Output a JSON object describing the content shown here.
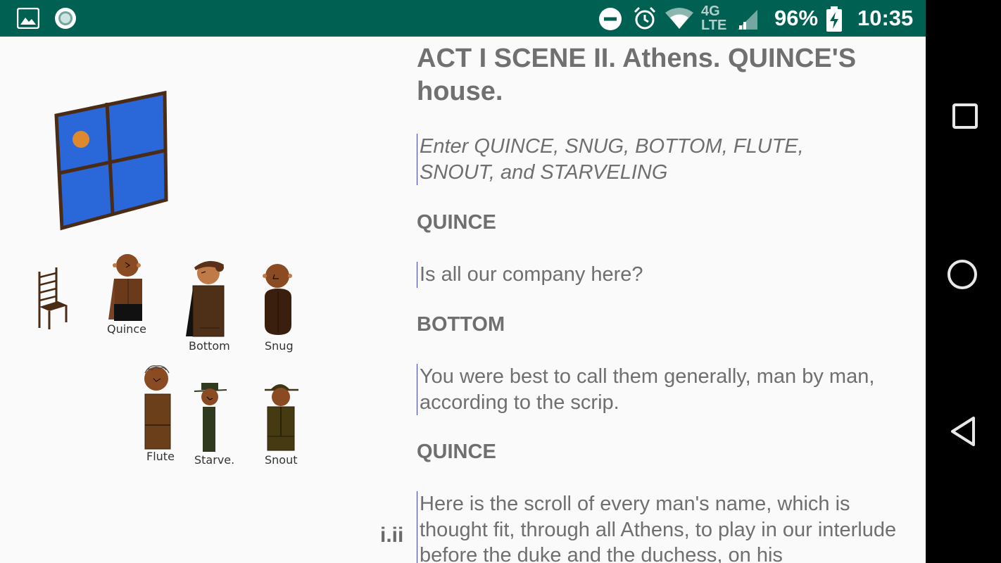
{
  "status_bar": {
    "battery": "96%",
    "time": "10:35",
    "network": "4G LTE"
  },
  "stage": {
    "characters": [
      {
        "name": "Quince"
      },
      {
        "name": "Bottom"
      },
      {
        "name": "Snug"
      },
      {
        "name": "Flute"
      },
      {
        "name": "Starve."
      },
      {
        "name": "Snout"
      }
    ]
  },
  "script": {
    "scene_title": "ACT I SCENE II. Athens. QUINCE'S house.",
    "stage_direction": "Enter QUINCE, SNUG, BOTTOM, FLUTE, SNOUT, and STARVELING",
    "lines": [
      {
        "speaker": "QUINCE",
        "text": "Is all our company here?"
      },
      {
        "speaker": "BOTTOM",
        "text": "You were best to call them generally, man by man, according to the scrip."
      },
      {
        "speaker": "QUINCE",
        "text": "Here is the scroll of every man's name, which is thought fit, through all Athens, to play in our interlude before the duke and the duchess, on his"
      }
    ],
    "scene_marker": "i.ii"
  },
  "colors": {
    "status_bar": "#006052",
    "window_glass": "#2a67d9",
    "window_frame": "#4a2b15",
    "accent_line": "#3b3fd8"
  }
}
